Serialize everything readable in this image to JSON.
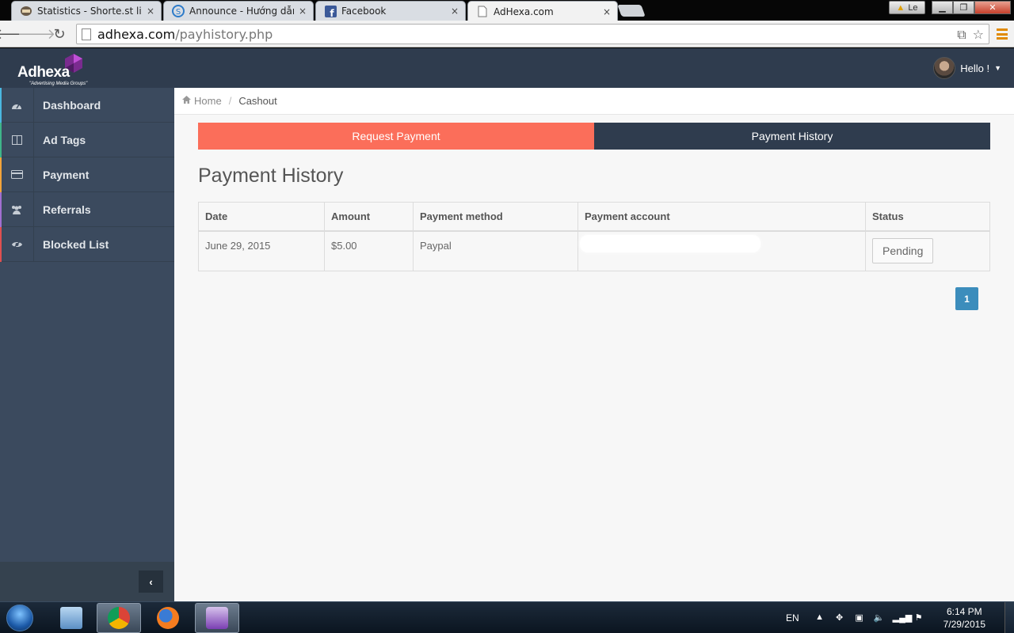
{
  "browser": {
    "tabs": [
      {
        "title": "Statistics - Shorte.st links",
        "icon": "shortest-icon",
        "close": "×"
      },
      {
        "title": "Announce - Hướng dẫn cá",
        "icon": "forum-icon",
        "close": "×"
      },
      {
        "title": "Facebook",
        "icon": "facebook-icon",
        "close": "×"
      },
      {
        "title": "AdHexa.com",
        "icon": "page-icon",
        "close": "×"
      }
    ],
    "profile_label": "Le",
    "url_host": "adhexa.com",
    "url_path": "/payhistory.php"
  },
  "header": {
    "logo_text": "Adhexa",
    "logo_tagline": "\"Advertising Media Groups\"",
    "greeting": "Hello !"
  },
  "sidebar": {
    "items": [
      {
        "label": "Dashboard",
        "icon": "dashboard-icon",
        "accent": "#4ab7e0"
      },
      {
        "label": "Ad Tags",
        "icon": "columns-icon",
        "accent": "#3fb58a"
      },
      {
        "label": "Payment",
        "icon": "credit-card-icon",
        "accent": "#f2a33a"
      },
      {
        "label": "Referrals",
        "icon": "users-icon",
        "accent": "#a26fd1"
      },
      {
        "label": "Blocked List",
        "icon": "eye-slash-icon",
        "accent": "#e05050"
      }
    ],
    "collapse_label": "‹"
  },
  "breadcrumb": {
    "home": "Home",
    "separator": "/",
    "current": "Cashout"
  },
  "tabs": {
    "request": "Request Payment",
    "history": "Payment History"
  },
  "page_title": "Payment History",
  "table": {
    "columns": [
      "Date",
      "Amount",
      "Payment method",
      "Payment account",
      "Status"
    ],
    "rows": [
      {
        "date": "June 29, 2015",
        "amount": "$5.00",
        "method": "Paypal",
        "account": "",
        "status": "Pending"
      }
    ]
  },
  "pagination": {
    "current": "1"
  },
  "taskbar": {
    "language": "EN",
    "time": "6:14 PM",
    "date": "7/29/2015"
  },
  "colors": {
    "header_bg": "#2f3c4e",
    "sidebar_bg": "#3b4a5e",
    "request_tab": "#fb6e5a",
    "history_tab": "#2f3c4e",
    "pager": "#3c8dbc"
  }
}
